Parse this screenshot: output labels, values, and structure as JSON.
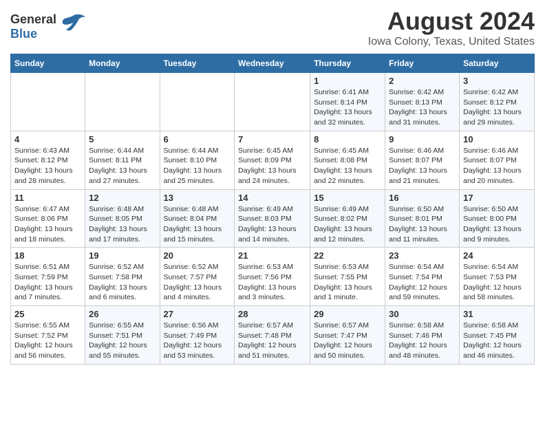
{
  "header": {
    "logo_general": "General",
    "logo_blue": "Blue",
    "title": "August 2024",
    "subtitle": "Iowa Colony, Texas, United States"
  },
  "calendar": {
    "days_of_week": [
      "Sunday",
      "Monday",
      "Tuesday",
      "Wednesday",
      "Thursday",
      "Friday",
      "Saturday"
    ],
    "weeks": [
      [
        {
          "day": "",
          "info": ""
        },
        {
          "day": "",
          "info": ""
        },
        {
          "day": "",
          "info": ""
        },
        {
          "day": "",
          "info": ""
        },
        {
          "day": "1",
          "info": "Sunrise: 6:41 AM\nSunset: 8:14 PM\nDaylight: 13 hours\nand 32 minutes."
        },
        {
          "day": "2",
          "info": "Sunrise: 6:42 AM\nSunset: 8:13 PM\nDaylight: 13 hours\nand 31 minutes."
        },
        {
          "day": "3",
          "info": "Sunrise: 6:42 AM\nSunset: 8:12 PM\nDaylight: 13 hours\nand 29 minutes."
        }
      ],
      [
        {
          "day": "4",
          "info": "Sunrise: 6:43 AM\nSunset: 8:12 PM\nDaylight: 13 hours\nand 28 minutes."
        },
        {
          "day": "5",
          "info": "Sunrise: 6:44 AM\nSunset: 8:11 PM\nDaylight: 13 hours\nand 27 minutes."
        },
        {
          "day": "6",
          "info": "Sunrise: 6:44 AM\nSunset: 8:10 PM\nDaylight: 13 hours\nand 25 minutes."
        },
        {
          "day": "7",
          "info": "Sunrise: 6:45 AM\nSunset: 8:09 PM\nDaylight: 13 hours\nand 24 minutes."
        },
        {
          "day": "8",
          "info": "Sunrise: 6:45 AM\nSunset: 8:08 PM\nDaylight: 13 hours\nand 22 minutes."
        },
        {
          "day": "9",
          "info": "Sunrise: 6:46 AM\nSunset: 8:07 PM\nDaylight: 13 hours\nand 21 minutes."
        },
        {
          "day": "10",
          "info": "Sunrise: 6:46 AM\nSunset: 8:07 PM\nDaylight: 13 hours\nand 20 minutes."
        }
      ],
      [
        {
          "day": "11",
          "info": "Sunrise: 6:47 AM\nSunset: 8:06 PM\nDaylight: 13 hours\nand 18 minutes."
        },
        {
          "day": "12",
          "info": "Sunrise: 6:48 AM\nSunset: 8:05 PM\nDaylight: 13 hours\nand 17 minutes."
        },
        {
          "day": "13",
          "info": "Sunrise: 6:48 AM\nSunset: 8:04 PM\nDaylight: 13 hours\nand 15 minutes."
        },
        {
          "day": "14",
          "info": "Sunrise: 6:49 AM\nSunset: 8:03 PM\nDaylight: 13 hours\nand 14 minutes."
        },
        {
          "day": "15",
          "info": "Sunrise: 6:49 AM\nSunset: 8:02 PM\nDaylight: 13 hours\nand 12 minutes."
        },
        {
          "day": "16",
          "info": "Sunrise: 6:50 AM\nSunset: 8:01 PM\nDaylight: 13 hours\nand 11 minutes."
        },
        {
          "day": "17",
          "info": "Sunrise: 6:50 AM\nSunset: 8:00 PM\nDaylight: 13 hours\nand 9 minutes."
        }
      ],
      [
        {
          "day": "18",
          "info": "Sunrise: 6:51 AM\nSunset: 7:59 PM\nDaylight: 13 hours\nand 7 minutes."
        },
        {
          "day": "19",
          "info": "Sunrise: 6:52 AM\nSunset: 7:58 PM\nDaylight: 13 hours\nand 6 minutes."
        },
        {
          "day": "20",
          "info": "Sunrise: 6:52 AM\nSunset: 7:57 PM\nDaylight: 13 hours\nand 4 minutes."
        },
        {
          "day": "21",
          "info": "Sunrise: 6:53 AM\nSunset: 7:56 PM\nDaylight: 13 hours\nand 3 minutes."
        },
        {
          "day": "22",
          "info": "Sunrise: 6:53 AM\nSunset: 7:55 PM\nDaylight: 13 hours\nand 1 minute."
        },
        {
          "day": "23",
          "info": "Sunrise: 6:54 AM\nSunset: 7:54 PM\nDaylight: 12 hours\nand 59 minutes."
        },
        {
          "day": "24",
          "info": "Sunrise: 6:54 AM\nSunset: 7:53 PM\nDaylight: 12 hours\nand 58 minutes."
        }
      ],
      [
        {
          "day": "25",
          "info": "Sunrise: 6:55 AM\nSunset: 7:52 PM\nDaylight: 12 hours\nand 56 minutes."
        },
        {
          "day": "26",
          "info": "Sunrise: 6:55 AM\nSunset: 7:51 PM\nDaylight: 12 hours\nand 55 minutes."
        },
        {
          "day": "27",
          "info": "Sunrise: 6:56 AM\nSunset: 7:49 PM\nDaylight: 12 hours\nand 53 minutes."
        },
        {
          "day": "28",
          "info": "Sunrise: 6:57 AM\nSunset: 7:48 PM\nDaylight: 12 hours\nand 51 minutes."
        },
        {
          "day": "29",
          "info": "Sunrise: 6:57 AM\nSunset: 7:47 PM\nDaylight: 12 hours\nand 50 minutes."
        },
        {
          "day": "30",
          "info": "Sunrise: 6:58 AM\nSunset: 7:46 PM\nDaylight: 12 hours\nand 48 minutes."
        },
        {
          "day": "31",
          "info": "Sunrise: 6:58 AM\nSunset: 7:45 PM\nDaylight: 12 hours\nand 46 minutes."
        }
      ]
    ]
  }
}
